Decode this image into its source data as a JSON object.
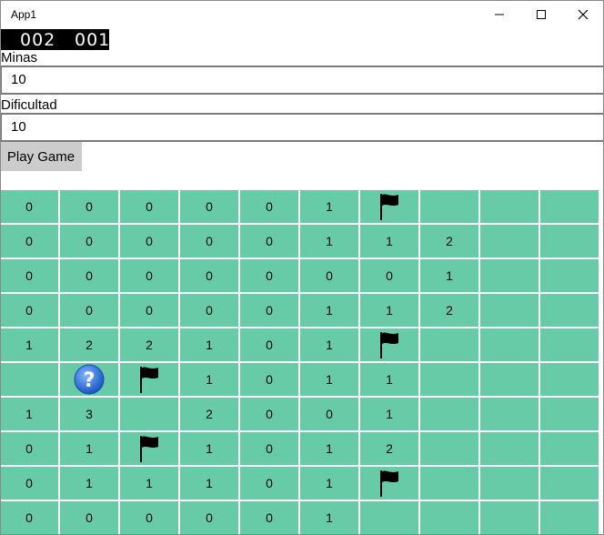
{
  "window": {
    "title": "App1"
  },
  "counter": {
    "left": "002",
    "right": "001"
  },
  "fields": {
    "mines_label": "Minas",
    "mines_value": "10",
    "difficulty_label": "Dificultad",
    "difficulty_value": "10"
  },
  "play_button_label": "Play Game",
  "board": {
    "rows": [
      [
        "0",
        "0",
        "0",
        "0",
        "0",
        "1",
        "@flag",
        "",
        "",
        ""
      ],
      [
        "0",
        "0",
        "0",
        "0",
        "0",
        "1",
        "1",
        "2",
        "",
        ""
      ],
      [
        "0",
        "0",
        "0",
        "0",
        "0",
        "0",
        "0",
        "1",
        "",
        ""
      ],
      [
        "0",
        "0",
        "0",
        "0",
        "0",
        "1",
        "1",
        "2",
        "",
        ""
      ],
      [
        "1",
        "2",
        "2",
        "1",
        "0",
        "1",
        "@flag",
        "",
        "",
        ""
      ],
      [
        "",
        "@question",
        "@flag",
        "1",
        "0",
        "1",
        "1",
        "",
        "",
        ""
      ],
      [
        "1",
        "3",
        "",
        "2",
        "0",
        "0",
        "1",
        "",
        "",
        ""
      ],
      [
        "0",
        "1",
        "@flag",
        "1",
        "0",
        "1",
        "2",
        "",
        "",
        ""
      ],
      [
        "0",
        "1",
        "1",
        "1",
        "0",
        "1",
        "@flag",
        "",
        "",
        ""
      ],
      [
        "0",
        "0",
        "0",
        "0",
        "0",
        "1",
        "",
        "",
        "",
        ""
      ]
    ]
  },
  "icons": {
    "flag": "flag-icon",
    "question": "question-icon"
  },
  "colors": {
    "cell": "#67cba7",
    "counter_bg": "#000000",
    "button_bg": "#cccccc"
  }
}
